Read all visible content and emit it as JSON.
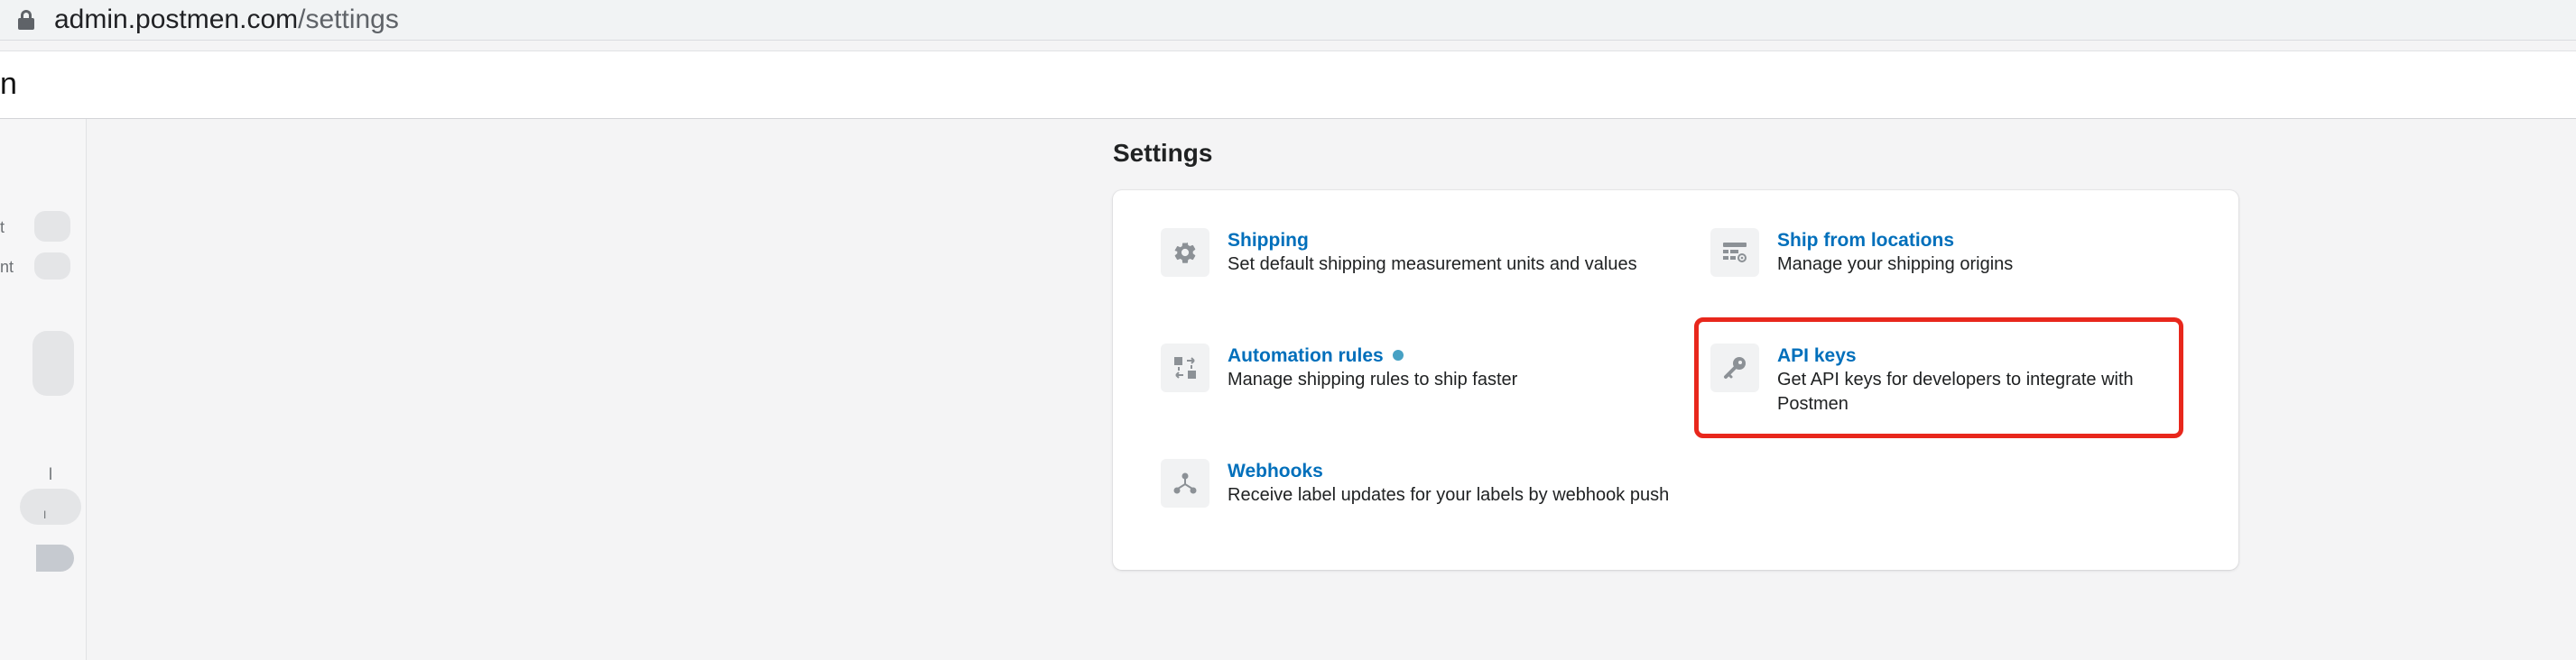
{
  "browser": {
    "url_host": "admin.postmen.com",
    "url_path": "/settings"
  },
  "header": {
    "brand_fragment": "n"
  },
  "sidebar": {
    "labels": [
      "t",
      "nt",
      "l",
      "I"
    ]
  },
  "page": {
    "title": "Settings"
  },
  "settings": [
    {
      "title": "Shipping",
      "description": "Set default shipping measurement units and values",
      "icon": "gear-icon"
    },
    {
      "title": "Ship from locations",
      "description": "Manage your shipping origins",
      "icon": "locations-icon"
    },
    {
      "title": "Automation rules",
      "description": "Manage shipping rules to ship faster",
      "icon": "automation-icon",
      "badge_color": "#47a1c4"
    },
    {
      "title": "API keys",
      "description": "Get API keys for developers to integrate with Postmen",
      "icon": "key-icon"
    },
    {
      "title": "Webhooks",
      "description": "Receive label updates for your labels by webhook push",
      "icon": "webhook-icon"
    }
  ],
  "colors": {
    "link": "#006fbb",
    "highlight": "#e8271c",
    "icon": "#8c9196"
  }
}
